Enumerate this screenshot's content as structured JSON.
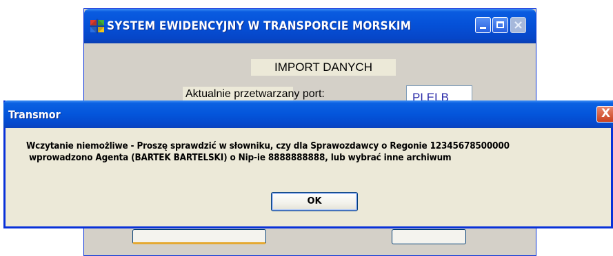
{
  "main_window": {
    "title": "SYSTEM EWIDENCYJNY W TRANSPORCIE MORSKIM",
    "heading": "IMPORT DANYCH",
    "port_label": "Aktualnie przetwarzany port:",
    "port_value": "PLELB"
  },
  "dialog": {
    "title": "Transmor",
    "message_line1": "Wczytanie niemożliwe - Proszę sprawdzić w słowniku, czy dla Sprawozdawcy o Regonie 12345678500000",
    "message_line2": " wprowadzono Agenta (BARTEK BARTELSKI) o Nip-ie 8888888888, lub wybrać inne archiwum",
    "ok_label": "OK",
    "close_glyph": "X"
  },
  "colors": {
    "titlebar_blue": "#0455db",
    "window_face": "#ece9d8",
    "close_red": "#c8411f"
  }
}
